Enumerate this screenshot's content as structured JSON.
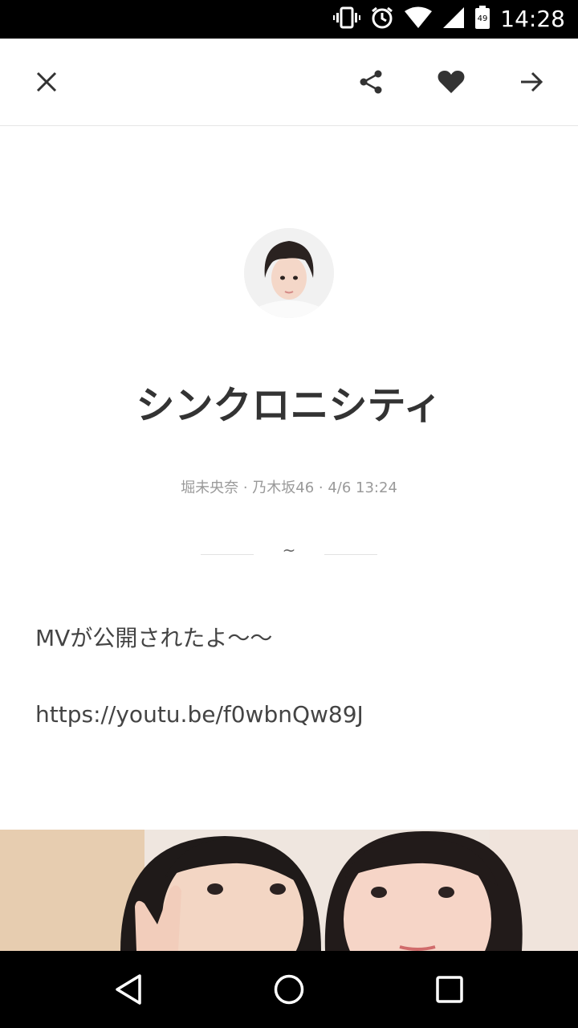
{
  "status_bar": {
    "time": "14:28",
    "battery_level": "49",
    "icons": [
      "vibrate-icon",
      "alarm-icon",
      "wifi-icon",
      "signal-icon",
      "battery-icon"
    ]
  },
  "top_bar": {
    "icons": [
      "close-icon",
      "share-icon",
      "heart-icon",
      "arrow-right-icon"
    ]
  },
  "post": {
    "title": "シンクロニシティ",
    "meta": "堀未央奈 · 乃木坂46 · 4/6 13:24",
    "divider_symbol": "~",
    "body_line_1": "MVが公開されたよ〜〜",
    "link": "https://youtu.be/f0wbnQw89J"
  },
  "nav_bar": {
    "icons": [
      "back-triangle-icon",
      "home-circle-icon",
      "recents-square-icon"
    ]
  },
  "colors": {
    "title": "#333333",
    "meta": "#9a9a9a",
    "status_bar_bg": "#000000",
    "nav_bar_bg": "#000000"
  }
}
